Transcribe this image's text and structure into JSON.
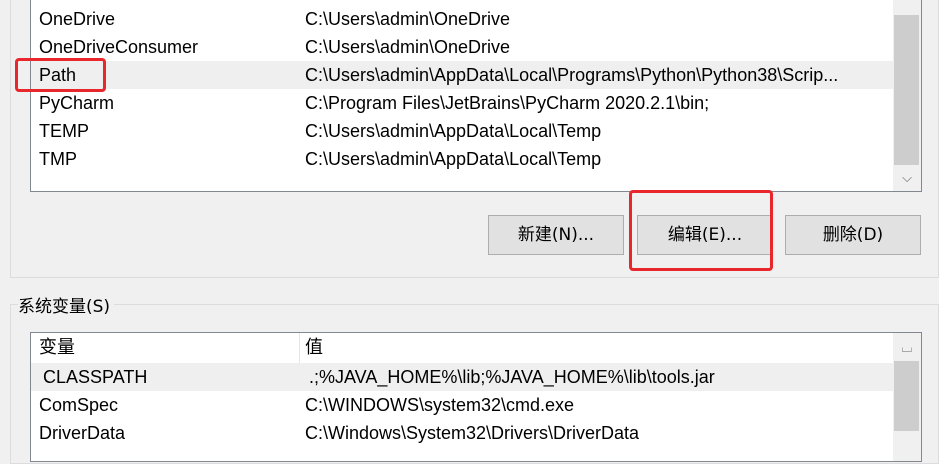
{
  "user_vars": {
    "rows": [
      {
        "name": "OneDrive",
        "value": "C:\\Users\\admin\\OneDrive"
      },
      {
        "name": "OneDriveConsumer",
        "value": "C:\\Users\\admin\\OneDrive"
      },
      {
        "name": "Path",
        "value": "C:\\Users\\admin\\AppData\\Local\\Programs\\Python\\Python38\\Scrip..."
      },
      {
        "name": "PyCharm",
        "value": "C:\\Program Files\\JetBrains\\PyCharm 2020.2.1\\bin;"
      },
      {
        "name": "TEMP",
        "value": "C:\\Users\\admin\\AppData\\Local\\Temp"
      },
      {
        "name": "TMP",
        "value": "C:\\Users\\admin\\AppData\\Local\\Temp"
      }
    ],
    "selected_index": 2
  },
  "buttons": {
    "new_label": "新建(N)...",
    "edit_label": "编辑(E)...",
    "delete_label": "删除(D)"
  },
  "system_vars": {
    "group_label": "系统变量(S)",
    "header_name": "变量",
    "header_value": "值",
    "rows": [
      {
        "name": "CLASSPATH",
        "value": ".;%JAVA_HOME%\\lib;%JAVA_HOME%\\lib\\tools.jar"
      },
      {
        "name": "ComSpec",
        "value": "C:\\WINDOWS\\system32\\cmd.exe"
      },
      {
        "name": "DriverData",
        "value": "C:\\Windows\\System32\\Drivers\\DriverData"
      }
    ],
    "selected_index": 0
  },
  "colors": {
    "highlight": "#e8262b",
    "selection": "#efefef"
  }
}
